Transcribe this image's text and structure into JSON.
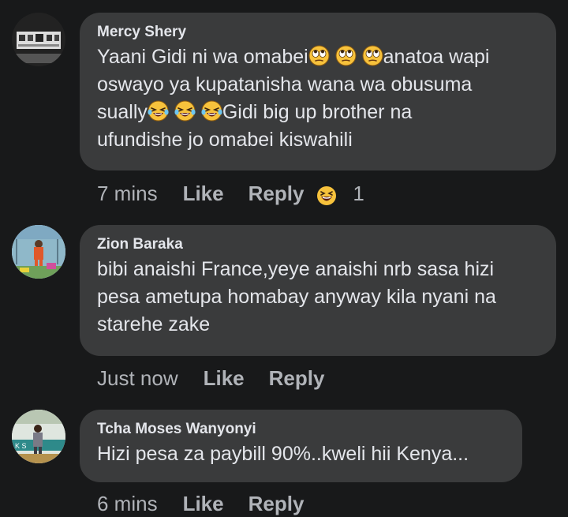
{
  "comments": [
    {
      "author": "Mercy Shery",
      "text_lines": [
        "Yaani Gidi ni wa omabei",
        "anatoa wapi",
        "oswayo ya kupatanisha wana wa obusuma",
        "sually",
        "Gidi big up brother na",
        "ufundishe jo omabei kiswahili"
      ],
      "time": "7 mins",
      "like": "Like",
      "reply": "Reply",
      "reaction_icon": "laughing-emoji-icon",
      "reaction_count": "1"
    },
    {
      "author": "Zion Baraka",
      "text_lines": [
        "bibi anaishi France,yeye anaishi nrb sasa hizi",
        "pesa ametupa homabay anyway kila nyani na",
        "starehe zake"
      ],
      "time": "Just now",
      "like": "Like",
      "reply": "Reply"
    },
    {
      "author": "Tcha Moses Wanyonyi",
      "text_lines": [
        "Hizi pesa za paybill 90%..kweli hii Kenya..."
      ],
      "time": "6 mins",
      "like": "Like",
      "reply": "Reply"
    }
  ],
  "colors": {
    "background": "#18191a",
    "bubble": "#3a3b3c",
    "text": "#e4e6eb",
    "muted": "#b0b3b8"
  }
}
